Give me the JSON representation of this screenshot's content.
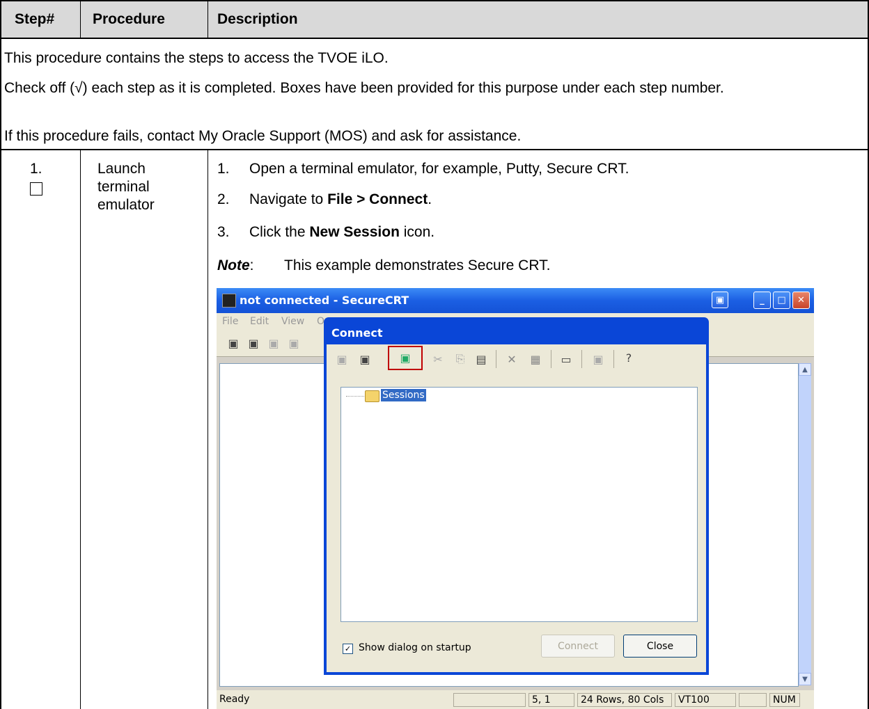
{
  "table": {
    "headers": {
      "step": "Step#",
      "procedure": "Procedure",
      "description": "Description"
    },
    "intro": [
      "This procedure contains the steps to access the TVOE iLO.",
      "Check off (√) each step as it is completed.  Boxes have been provided for this purpose under each step number.",
      "If this procedure fails, contact My Oracle Support (MOS) and ask for assistance."
    ],
    "row1": {
      "step_number": "1.",
      "procedure_lines": [
        "Launch",
        "terminal",
        "emulator"
      ],
      "steps": [
        {
          "num": "1.",
          "text": "Open a terminal emulator, for example, Putty, Secure CRT."
        },
        {
          "num": "2.",
          "pre": "Navigate to ",
          "bold": "File > Connect",
          "post": "."
        },
        {
          "num": "3.",
          "pre": "Click the ",
          "bold": "New Session",
          "post": " icon."
        }
      ],
      "note_label": "Note",
      "note_colon": ":",
      "note_text": "This example demonstrates Secure CRT."
    }
  },
  "screenshot": {
    "window_title": "not connected - SecureCRT",
    "menu": [
      "File",
      "Edit",
      "View",
      "O"
    ],
    "dialog_title": "Connect",
    "tree_item": "Sessions",
    "checkbox_label": "Show dialog on startup",
    "checkbox_checked": true,
    "connect_button": "Connect",
    "close_button": "Close",
    "status": {
      "ready": "Ready",
      "cursor": "5,  1",
      "size": "24 Rows, 80 Cols",
      "term": "VT100",
      "num": "NUM"
    },
    "titlebar_color": "#1b5fe3",
    "highlight_color": "#c00000"
  }
}
